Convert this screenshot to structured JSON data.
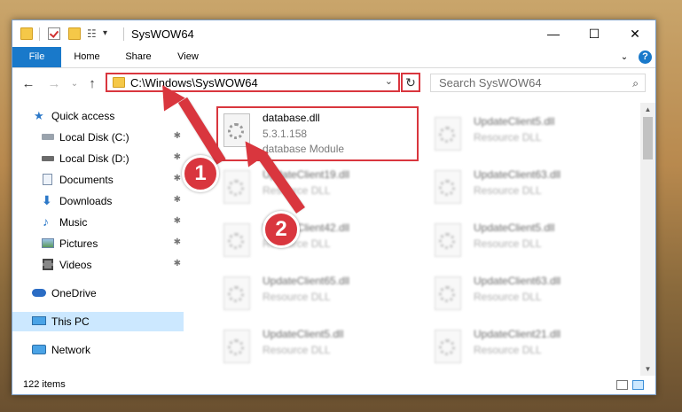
{
  "window": {
    "title": "SysWOW64",
    "minimize": "—",
    "maximize": "☐",
    "close": "✕"
  },
  "ribbon": {
    "tabs": [
      "File",
      "Home",
      "Share",
      "View"
    ],
    "help": "?"
  },
  "nav": {
    "back": "←",
    "forward": "→",
    "up": "↑",
    "address": "C:\\Windows\\SysWOW64",
    "address_chevron": "⌄",
    "refresh": "↻",
    "search_placeholder": "Search SysWOW64",
    "search_icon": "⌕"
  },
  "sidebar": {
    "items": [
      {
        "label": "Quick access",
        "icon": "star-icon",
        "pinned": false
      },
      {
        "label": "Local Disk (C:)",
        "icon": "drive-icon",
        "pinned": true
      },
      {
        "label": "Local Disk (D:)",
        "icon": "drive-icon",
        "pinned": true
      },
      {
        "label": "Documents",
        "icon": "documents-icon",
        "pinned": true
      },
      {
        "label": "Downloads",
        "icon": "download-icon",
        "pinned": true
      },
      {
        "label": "Music",
        "icon": "music-icon",
        "pinned": true
      },
      {
        "label": "Pictures",
        "icon": "pictures-icon",
        "pinned": true
      },
      {
        "label": "Videos",
        "icon": "videos-icon",
        "pinned": true
      },
      {
        "label": "OneDrive",
        "icon": "cloud-icon",
        "pinned": false
      },
      {
        "label": "This PC",
        "icon": "computer-icon",
        "pinned": false
      },
      {
        "label": "Network",
        "icon": "network-icon",
        "pinned": false
      }
    ],
    "pin_glyph": "📌"
  },
  "files": {
    "highlighted": {
      "name": "database.dll",
      "version": "5.3.1.158",
      "description": "database Module"
    },
    "col1": [
      {
        "name": "UpdateClient19.dll",
        "description": "Resource DLL"
      },
      {
        "name": "UpdateClient42.dll",
        "description": "Resource DLL"
      },
      {
        "name": "UpdateClient65.dll",
        "description": "Resource DLL"
      },
      {
        "name": "UpdateClient5.dll",
        "description": "Resource DLL"
      }
    ],
    "col2": [
      {
        "name": "UpdateClient5.dll",
        "description": "Resource DLL"
      },
      {
        "name": "UpdateClient63.dll",
        "description": "Resource DLL"
      },
      {
        "name": "UpdateClient5.dll",
        "description": "Resource DLL"
      },
      {
        "name": "UpdateClient63.dll",
        "description": "Resource DLL"
      },
      {
        "name": "UpdateClient21.dll",
        "description": "Resource DLL"
      }
    ]
  },
  "status": {
    "item_count": "122 items"
  },
  "annotations": {
    "badge1": "1",
    "badge2": "2"
  },
  "colors": {
    "accent": "#1979ca",
    "annotation": "#d9363e",
    "selection": "#cce8ff"
  }
}
